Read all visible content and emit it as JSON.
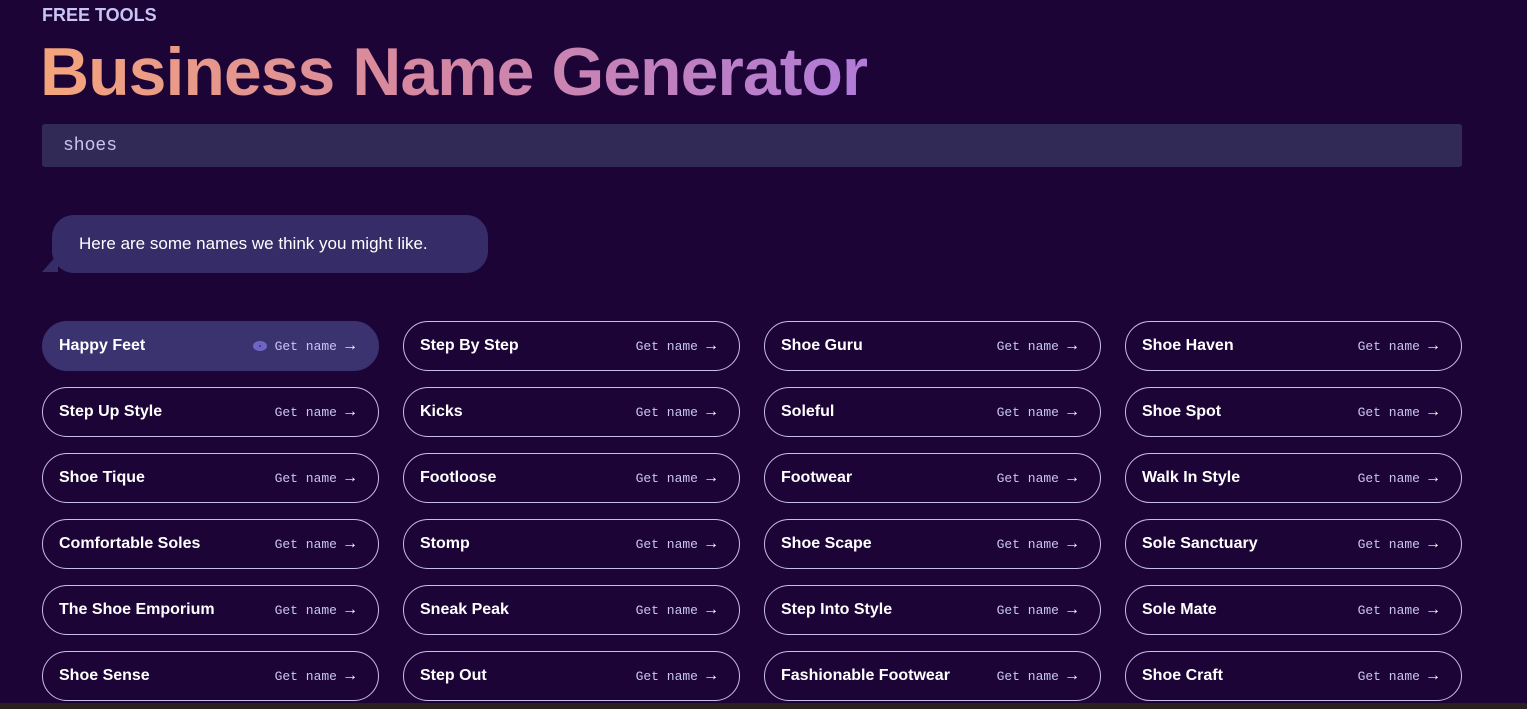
{
  "header": {
    "kicker": "FREE TOOLS",
    "title": "Business Name Generator"
  },
  "search": {
    "value": "shoes"
  },
  "message": "Here are some names we think you might like.",
  "get_label": "Get name",
  "arrow": "→",
  "names": [
    "Happy Feet",
    "Step By Step",
    "Shoe Guru",
    "Shoe Haven",
    "Step Up Style",
    "Kicks",
    "Soleful",
    "Shoe Spot",
    "Shoe Tique",
    "Footloose",
    "Footwear",
    "Walk In Style",
    "Comfortable Soles",
    "Stomp",
    "Shoe Scape",
    "Sole Sanctuary",
    "The Shoe Emporium",
    "Sneak Peak",
    "Step Into Style",
    "Sole Mate",
    "Shoe Sense",
    "Step Out",
    "Fashionable Footwear",
    "Shoe Craft"
  ],
  "active_index": 0,
  "colors": {
    "background": "#1c0536",
    "accent": "#3b3270"
  }
}
